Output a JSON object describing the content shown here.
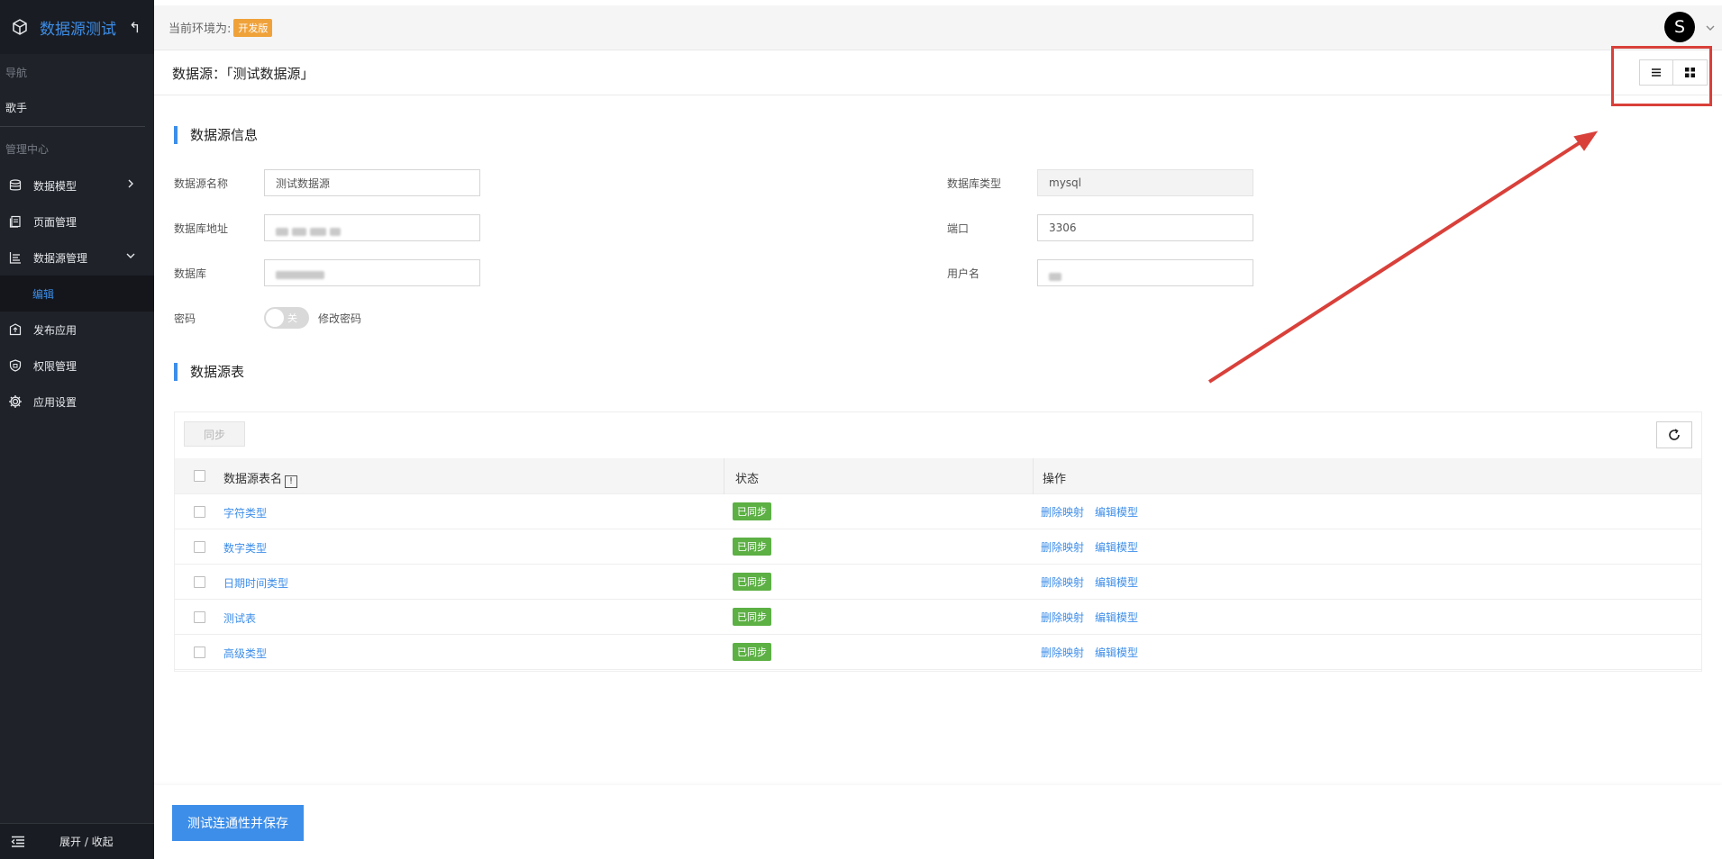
{
  "sidebar": {
    "app_title": "数据源测试",
    "section_nav": "导航",
    "nav_singer": "歌手",
    "section_admin": "管理中心",
    "items": [
      {
        "label": "数据模型"
      },
      {
        "label": "页面管理"
      },
      {
        "label": "数据源管理"
      },
      {
        "label": "编辑"
      },
      {
        "label": "发布应用"
      },
      {
        "label": "权限管理"
      },
      {
        "label": "应用设置"
      }
    ],
    "toggle_label": "展开 / 收起"
  },
  "topbar": {
    "env_label": "当前环境为:",
    "env_badge": "开发版",
    "avatar_letter": "S"
  },
  "header": {
    "title": "数据源：「测试数据源」"
  },
  "info_section": {
    "title": "数据源信息",
    "name_label": "数据源名称",
    "name_value": "测试数据源",
    "addr_label": "数据库地址",
    "db_label": "数据库",
    "pwd_label": "密码",
    "toggle_text": "关",
    "change_pwd": "修改密码",
    "dbtype_label": "数据库类型",
    "dbtype_value": "mysql",
    "port_label": "端口",
    "port_value": "3306",
    "user_label": "用户名"
  },
  "table_section": {
    "title": "数据源表",
    "sync_button": "同步",
    "columns": [
      "数据源表名",
      "状态",
      "操作"
    ],
    "info_mark": "!",
    "rows": [
      {
        "name": "字符类型",
        "status": "已同步",
        "del": "删除映射",
        "edit": "编辑模型"
      },
      {
        "name": "数字类型",
        "status": "已同步",
        "del": "删除映射",
        "edit": "编辑模型"
      },
      {
        "name": "日期时间类型",
        "status": "已同步",
        "del": "删除映射",
        "edit": "编辑模型"
      },
      {
        "name": "测试表",
        "status": "已同步",
        "del": "删除映射",
        "edit": "编辑模型"
      },
      {
        "name": "高级类型",
        "status": "已同步",
        "del": "删除映射",
        "edit": "编辑模型"
      }
    ]
  },
  "footer": {
    "save_button": "测试连通性并保存"
  },
  "colors": {
    "accent": "#3d8ee9",
    "sidebar_bg": "#1f2229",
    "env_badge": "#f0a23a",
    "status_green": "#5cb044",
    "annotation_red": "#d9403a"
  }
}
